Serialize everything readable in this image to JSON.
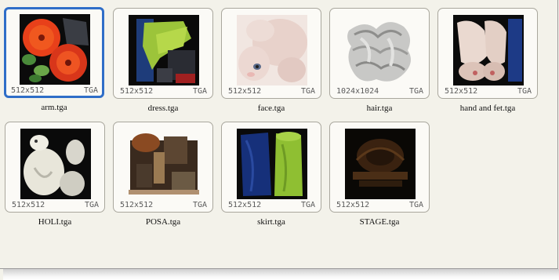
{
  "files": [
    {
      "name": "arm.tga",
      "dims": "512x512",
      "type": "TGA",
      "selected": true,
      "icon": "arm-texture-thumbnail"
    },
    {
      "name": "dress.tga",
      "dims": "512x512",
      "type": "TGA",
      "selected": false,
      "icon": "dress-texture-thumbnail"
    },
    {
      "name": "face.tga",
      "dims": "512x512",
      "type": "TGA",
      "selected": false,
      "icon": "face-texture-thumbnail"
    },
    {
      "name": "hair.tga",
      "dims": "1024x1024",
      "type": "TGA",
      "selected": false,
      "icon": "hair-texture-thumbnail"
    },
    {
      "name": "hand and fet.tga",
      "dims": "512x512",
      "type": "TGA",
      "selected": false,
      "icon": "hand-and-feet-texture-thumbnail"
    },
    {
      "name": "HOLI.tga",
      "dims": "512x512",
      "type": "TGA",
      "selected": false,
      "icon": "holi-texture-thumbnail"
    },
    {
      "name": "POSA.tga",
      "dims": "512x512",
      "type": "TGA",
      "selected": false,
      "icon": "posa-texture-thumbnail"
    },
    {
      "name": "skirt.tga",
      "dims": "512x512",
      "type": "TGA",
      "selected": false,
      "icon": "skirt-texture-thumbnail"
    },
    {
      "name": "STAGE.tga",
      "dims": "512x512",
      "type": "TGA",
      "selected": false,
      "icon": "stage-texture-thumbnail"
    }
  ],
  "colors": {
    "selection": "#2f6ec8",
    "background": "#f3f2ea"
  }
}
